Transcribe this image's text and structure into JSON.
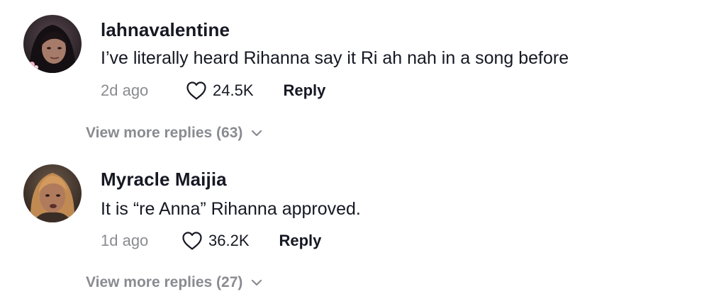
{
  "comments": [
    {
      "username": "lahnavalentine",
      "text": "I’ve literally heard Rihanna say it Ri ah nah in a song before",
      "time": "2d ago",
      "likes": "24.5K",
      "reply_label": "Reply",
      "view_more": "View more replies (63)"
    },
    {
      "username": "Myracle Maijia",
      "text": "It is “re Anna” Rihanna approved.",
      "time": "1d ago",
      "likes": "36.2K",
      "reply_label": "Reply",
      "view_more": "View more replies (27)"
    }
  ],
  "icons": {
    "like": "heart-outline-icon",
    "expand": "chevron-down-icon"
  },
  "colors": {
    "primary_text": "#161823",
    "secondary_text": "#8a8b91",
    "background": "#ffffff"
  }
}
